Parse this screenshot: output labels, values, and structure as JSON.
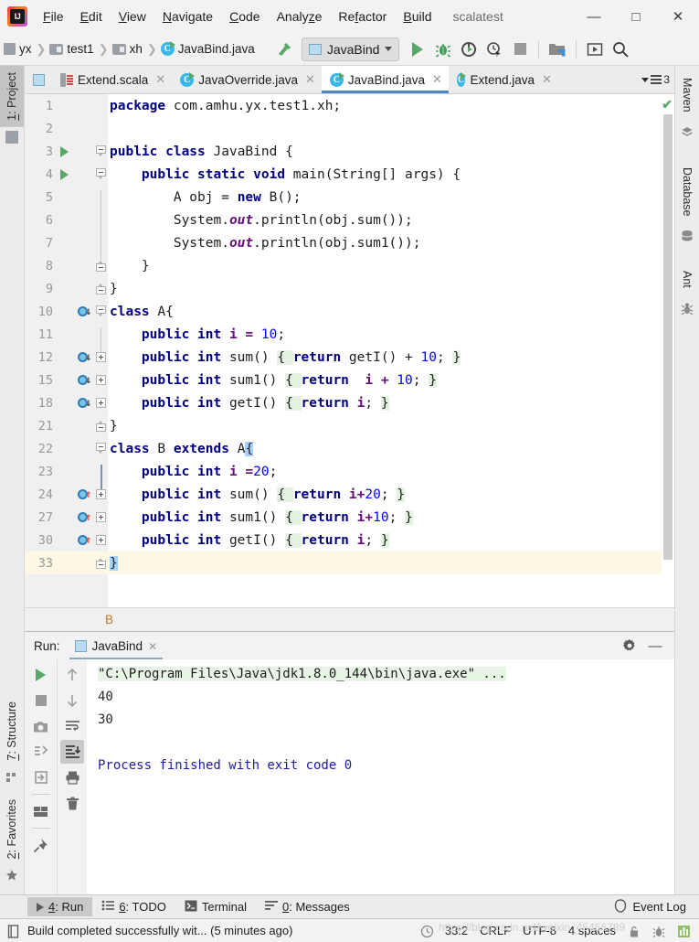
{
  "titlebar": {
    "logo_text": "IJ",
    "menus": [
      "File",
      "Edit",
      "View",
      "Navigate",
      "Code",
      "Analyze",
      "Refactor",
      "Build"
    ],
    "project_name": "scalatest",
    "minimize": "—",
    "maximize": "□",
    "close": "✕"
  },
  "navbar": {
    "breadcrumbs": [
      {
        "label": "yx",
        "icon": "module-icon"
      },
      {
        "label": "test1",
        "icon": "folder-icon"
      },
      {
        "label": "xh",
        "icon": "folder-icon"
      },
      {
        "label": "JavaBind.java",
        "icon": "java-class-icon"
      }
    ],
    "separator": "❯",
    "build_icon": "hammer-icon",
    "run_config": "JavaBind",
    "buttons": [
      {
        "name": "run-button",
        "glyph": "▶"
      },
      {
        "name": "debug-button",
        "glyph": "🐞"
      },
      {
        "name": "run-with-coverage-button",
        "glyph": "▶"
      },
      {
        "name": "profile-button",
        "glyph": "⏱"
      },
      {
        "name": "stop-button",
        "glyph": "■"
      },
      {
        "name": "project-structure-button",
        "glyph": "▣"
      },
      {
        "name": "update-project-button",
        "glyph": "▣"
      },
      {
        "name": "search-everywhere-button",
        "glyph": "🔍"
      }
    ]
  },
  "left_stripe": {
    "top": [
      {
        "label_prefix": "1",
        "label": ": Project",
        "active": true,
        "icon": "folder-icon"
      }
    ],
    "bottom": [
      {
        "label_prefix": "7",
        "label": ": Structure",
        "icon": "structure-icon"
      },
      {
        "label_prefix": "2",
        "label": ": Favorites",
        "icon": "star-icon"
      }
    ]
  },
  "right_stripe": [
    {
      "label": "Maven",
      "icon": "maven-icon"
    },
    {
      "label": "Database",
      "icon": "database-icon"
    },
    {
      "label": "Ant",
      "icon": "ant-icon"
    }
  ],
  "editor_tabs": {
    "tabs": [
      {
        "label": "Extend.scala",
        "icon": "scala-file-icon",
        "active": false
      },
      {
        "label": "JavaOverride.java",
        "icon": "java-class-icon",
        "active": false
      },
      {
        "label": "JavaBind.java",
        "icon": "java-class-icon",
        "active": true
      },
      {
        "label": "Extend.java",
        "icon": "java-class-icon",
        "active": false
      }
    ],
    "close_glyph": "✕",
    "overflow_count": "3"
  },
  "editor": {
    "breadcrumb_bottom": "B",
    "inspection_status": "✔",
    "lines": [
      {
        "num": "1",
        "gutter_run": false,
        "mark": "",
        "fold": "",
        "indent": 0,
        "tokens": [
          {
            "t": "package",
            "c": "kw"
          },
          {
            "t": " com.amhu.yx.test1.xh;",
            "c": "pl"
          }
        ]
      },
      {
        "num": "2",
        "gutter_run": false,
        "mark": "",
        "fold": "",
        "indent": 0,
        "tokens": []
      },
      {
        "num": "3",
        "gutter_run": true,
        "mark": "",
        "fold": "top",
        "indent": 0,
        "tokens": [
          {
            "t": "public class ",
            "c": "kw"
          },
          {
            "t": "JavaBind {",
            "c": "pl"
          }
        ]
      },
      {
        "num": "4",
        "gutter_run": true,
        "mark": "",
        "fold": "top",
        "indent": 1,
        "tokens": [
          {
            "t": "public static void ",
            "c": "kw"
          },
          {
            "t": "main(String[] args) {",
            "c": "pl"
          }
        ]
      },
      {
        "num": "5",
        "gutter_run": false,
        "mark": "",
        "fold": "bar",
        "indent": 2,
        "tokens": [
          {
            "t": "A obj = ",
            "c": "pl"
          },
          {
            "t": "new ",
            "c": "kw"
          },
          {
            "t": "B();",
            "c": "pl"
          }
        ]
      },
      {
        "num": "6",
        "gutter_run": false,
        "mark": "",
        "fold": "bar",
        "indent": 2,
        "tokens": [
          {
            "t": "System.",
            "c": "pl"
          },
          {
            "t": "out",
            "c": "stat"
          },
          {
            "t": ".println(obj.sum());",
            "c": "pl"
          }
        ]
      },
      {
        "num": "7",
        "gutter_run": false,
        "mark": "",
        "fold": "bar",
        "indent": 2,
        "tokens": [
          {
            "t": "System.",
            "c": "pl"
          },
          {
            "t": "out",
            "c": "stat"
          },
          {
            "t": ".println(obj.sum1());",
            "c": "pl"
          }
        ]
      },
      {
        "num": "8",
        "gutter_run": false,
        "mark": "",
        "fold": "bot",
        "indent": 1,
        "tokens": [
          {
            "t": "}",
            "c": "pl"
          }
        ]
      },
      {
        "num": "9",
        "gutter_run": false,
        "mark": "",
        "fold": "bot",
        "indent": 0,
        "tokens": [
          {
            "t": "}",
            "c": "pl"
          }
        ]
      },
      {
        "num": "10",
        "gutter_run": false,
        "mark": "impl-down",
        "fold": "top",
        "indent": 0,
        "tokens": [
          {
            "t": "class ",
            "c": "kw"
          },
          {
            "t": "A{",
            "c": "pl"
          }
        ]
      },
      {
        "num": "11",
        "gutter_run": false,
        "mark": "",
        "fold": "bar",
        "indent": 1,
        "tokens": [
          {
            "t": "public int ",
            "c": "kw"
          },
          {
            "t": "i = ",
            "c": "fld"
          },
          {
            "t": "10",
            "c": "num"
          },
          {
            "t": ";",
            "c": "pl"
          }
        ]
      },
      {
        "num": "12",
        "gutter_run": false,
        "mark": "impl-down",
        "fold": "plus",
        "indent": 1,
        "tokens": [
          {
            "t": "public int ",
            "c": "kw"
          },
          {
            "t": "sum() ",
            "c": "pl"
          },
          {
            "t": "{ ",
            "c": "pl fold-hl"
          },
          {
            "t": "return ",
            "c": "kw"
          },
          {
            "t": "getI() + ",
            "c": "pl"
          },
          {
            "t": "10",
            "c": "num"
          },
          {
            "t": "; ",
            "c": "pl"
          },
          {
            "t": "}",
            "c": "pl fold-hl"
          }
        ]
      },
      {
        "num": "15",
        "gutter_run": false,
        "mark": "impl-down",
        "fold": "plus",
        "indent": 1,
        "tokens": [
          {
            "t": "public int ",
            "c": "kw"
          },
          {
            "t": "sum1() ",
            "c": "pl"
          },
          {
            "t": "{ ",
            "c": "pl fold-hl"
          },
          {
            "t": "return ",
            "c": "kw"
          },
          {
            "t": " i + ",
            "c": "fld"
          },
          {
            "t": "10",
            "c": "num"
          },
          {
            "t": "; ",
            "c": "pl"
          },
          {
            "t": "}",
            "c": "pl fold-hl"
          }
        ]
      },
      {
        "num": "18",
        "gutter_run": false,
        "mark": "impl-down",
        "fold": "plus",
        "indent": 1,
        "tokens": [
          {
            "t": "public int ",
            "c": "kw"
          },
          {
            "t": "getI() ",
            "c": "pl"
          },
          {
            "t": "{ ",
            "c": "pl fold-hl"
          },
          {
            "t": "return ",
            "c": "kw"
          },
          {
            "t": "i",
            "c": "fld"
          },
          {
            "t": "; ",
            "c": "pl"
          },
          {
            "t": "}",
            "c": "pl fold-hl"
          }
        ]
      },
      {
        "num": "21",
        "gutter_run": false,
        "mark": "",
        "fold": "bot",
        "indent": 0,
        "tokens": [
          {
            "t": "}",
            "c": "pl"
          }
        ]
      },
      {
        "num": "22",
        "gutter_run": false,
        "mark": "",
        "fold": "topdark",
        "indent": 0,
        "tokens": [
          {
            "t": "class ",
            "c": "kw"
          },
          {
            "t": "B ",
            "c": "pl"
          },
          {
            "t": "extends ",
            "c": "kw"
          },
          {
            "t": "A",
            "c": "pl"
          },
          {
            "t": "{",
            "c": "pl sel-hl"
          }
        ]
      },
      {
        "num": "23",
        "gutter_run": false,
        "mark": "",
        "fold": "bardark",
        "indent": 1,
        "tokens": [
          {
            "t": "public int ",
            "c": "kw"
          },
          {
            "t": "i =",
            "c": "fld"
          },
          {
            "t": "20",
            "c": "num"
          },
          {
            "t": ";",
            "c": "pl"
          }
        ]
      },
      {
        "num": "24",
        "gutter_run": false,
        "mark": "ovr-up",
        "fold": "plusdark",
        "indent": 1,
        "tokens": [
          {
            "t": "public int ",
            "c": "kw"
          },
          {
            "t": "sum() ",
            "c": "pl"
          },
          {
            "t": "{ ",
            "c": "pl fold-hl"
          },
          {
            "t": "return ",
            "c": "kw"
          },
          {
            "t": "i+",
            "c": "fld"
          },
          {
            "t": "20",
            "c": "num"
          },
          {
            "t": "; ",
            "c": "pl"
          },
          {
            "t": "}",
            "c": "pl fold-hl"
          }
        ]
      },
      {
        "num": "27",
        "gutter_run": false,
        "mark": "ovr-up",
        "fold": "plusdark",
        "indent": 1,
        "tokens": [
          {
            "t": "public int ",
            "c": "kw"
          },
          {
            "t": "sum1() ",
            "c": "pl"
          },
          {
            "t": "{ ",
            "c": "pl fold-hl"
          },
          {
            "t": "return ",
            "c": "kw"
          },
          {
            "t": "i+",
            "c": "fld"
          },
          {
            "t": "10",
            "c": "num"
          },
          {
            "t": "; ",
            "c": "pl"
          },
          {
            "t": "}",
            "c": "pl fold-hl"
          }
        ]
      },
      {
        "num": "30",
        "gutter_run": false,
        "mark": "ovr-up",
        "fold": "plusdark",
        "indent": 1,
        "tokens": [
          {
            "t": "public int ",
            "c": "kw"
          },
          {
            "t": "getI() ",
            "c": "pl"
          },
          {
            "t": "{ ",
            "c": "pl fold-hl"
          },
          {
            "t": "return ",
            "c": "kw"
          },
          {
            "t": "i",
            "c": "fld"
          },
          {
            "t": "; ",
            "c": "pl"
          },
          {
            "t": "}",
            "c": "pl fold-hl"
          }
        ]
      },
      {
        "num": "33",
        "gutter_run": false,
        "mark": "",
        "fold": "botdark",
        "indent": 0,
        "current": true,
        "tokens": [
          {
            "t": "}",
            "c": "pl sel-hl"
          }
        ]
      }
    ]
  },
  "run_panel": {
    "label": "Run:",
    "tab_label": "JavaBind",
    "close_glyph": "✕",
    "settings_glyph": "⚙",
    "minimize_glyph": "—",
    "console": {
      "command": "\"C:\\Program Files\\Java\\jdk1.8.0_144\\bin\\java.exe\" ...",
      "output": [
        "40",
        "30",
        "",
        "Process finished with exit code 0"
      ]
    },
    "tools_left": [
      "rerun-button",
      "stop-button",
      "snapshot-button",
      "restore-layout-button",
      "export-button",
      "layout-button",
      "pin-tab-button"
    ],
    "tools_right": [
      "up-button",
      "down-button",
      "soft-wrap-button",
      "scroll-to-end-button",
      "print-button",
      "clear-all-button"
    ]
  },
  "bottom_bar": {
    "items": [
      {
        "prefix": "4",
        "label": ": Run",
        "icon": "run-icon",
        "active": true
      },
      {
        "prefix": "6",
        "label": ": TODO",
        "icon": "todo-icon",
        "active": false
      },
      {
        "prefix": "",
        "label": "Terminal",
        "icon": "terminal-icon",
        "active": false
      },
      {
        "prefix": "0",
        "label": ": Messages",
        "icon": "messages-icon",
        "active": false
      }
    ],
    "event_log": "Event Log"
  },
  "statusbar": {
    "message": "Build completed successfully wit... (5 minutes ago)",
    "caret": "33:2",
    "line_sep": "CRLF",
    "encoding": "UTF-8",
    "indent": "4 spaces",
    "watermark": "https://blog.csdn.net/weixin_45456789",
    "icons": [
      "document-icon",
      "clock-icon",
      "lock-icon",
      "bug-icon",
      "memory-icon"
    ]
  },
  "colors": {
    "accent_blue": "#4a86c5",
    "green": "#59a869",
    "keyword": "#000080",
    "number": "#0000ff",
    "field": "#660e7a",
    "fold_highlight": "#e3f2e1",
    "selection": "#a6d2ff",
    "current_line": "#fdf8e3"
  }
}
